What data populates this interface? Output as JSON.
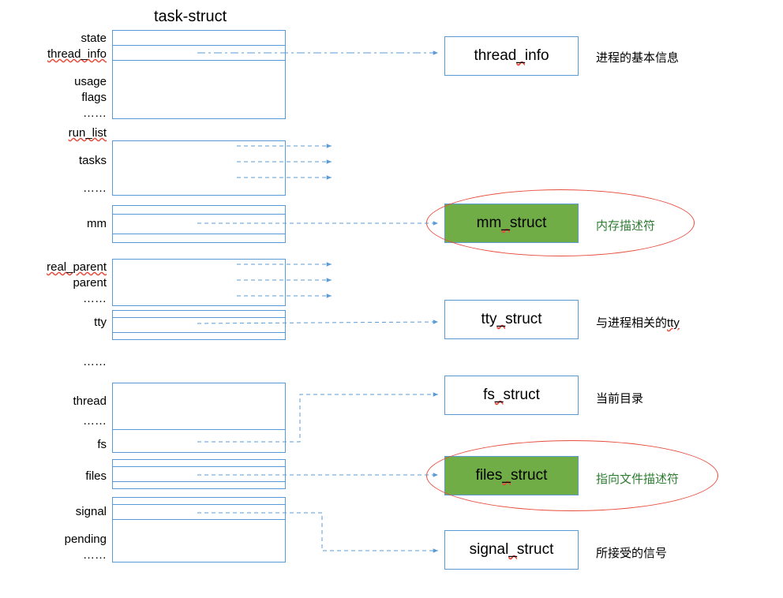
{
  "title": "task-struct",
  "labels": {
    "state": "state",
    "thread_info": "thread_info",
    "usage": "usage",
    "flags": "flags",
    "dots1": "……",
    "run_list": "run_list",
    "tasks": "tasks",
    "dots2": "……",
    "mm": "mm",
    "real_parent": "real_parent",
    "parent": "parent",
    "dots3": "……",
    "tty": "tty",
    "dots4": "……",
    "thread": "thread",
    "dots5": "……",
    "fs": "fs",
    "files": "files",
    "signal": "signal",
    "pending": "pending",
    "dots6": "……"
  },
  "targets": {
    "thread_info": {
      "pre": "thread",
      "u": "_",
      "post": "info"
    },
    "mm_struct": {
      "pre": "mm",
      "u": "_",
      "post": "struct"
    },
    "tty_struct": {
      "pre": "tty",
      "u": "_",
      "post": "struct"
    },
    "fs_struct": {
      "pre": "fs",
      "u": "_",
      "post": "struct"
    },
    "files_struct": {
      "pre": "files",
      "u": "_",
      "post": "struct"
    },
    "signal_struct": {
      "pre": "signal",
      "u": "_",
      "post": "struct"
    }
  },
  "descs": {
    "d1": "进程的基本信息",
    "d2": "内存描述符",
    "d3_pre": "与进程相关的",
    "d3_u": "tty",
    "d4": "当前目录",
    "d5": "指向文件描述符",
    "d6": "所接受的信号"
  }
}
